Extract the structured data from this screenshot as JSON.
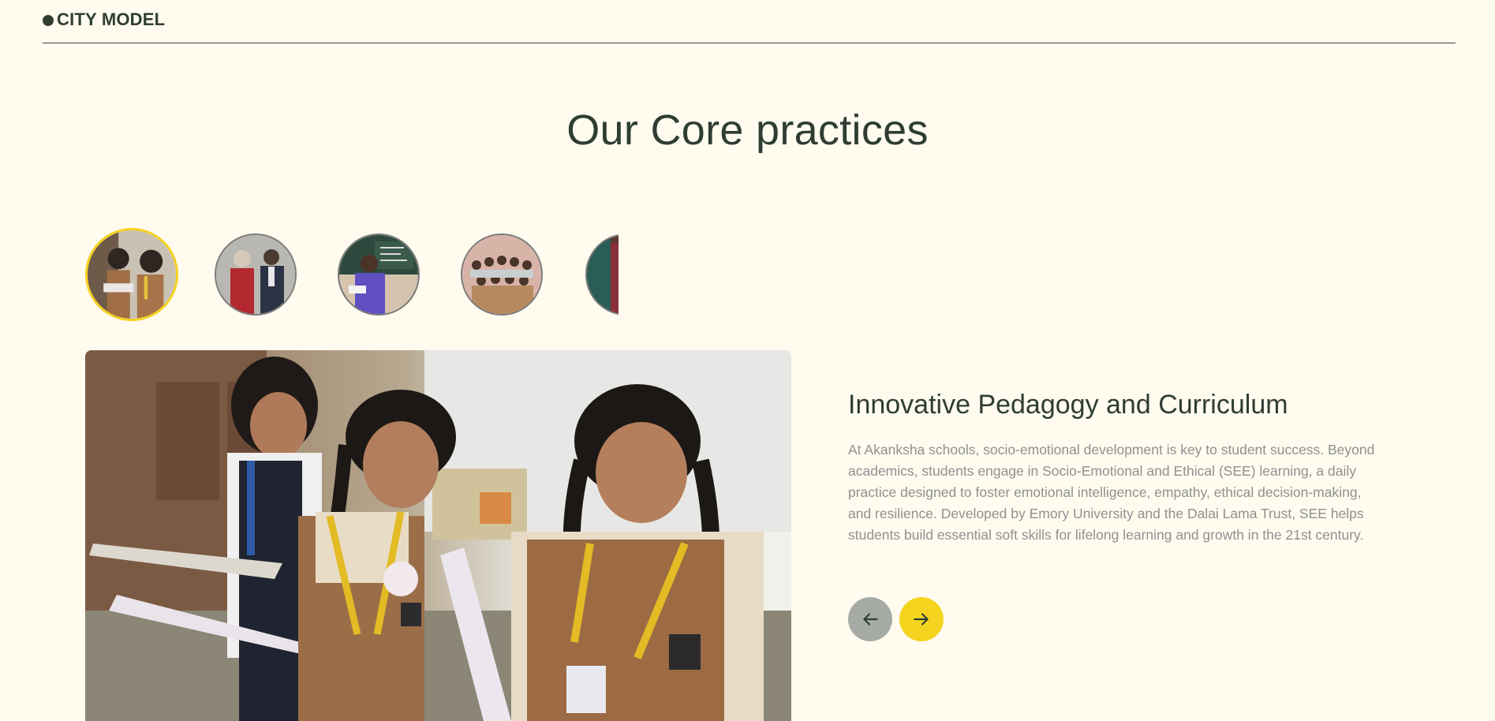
{
  "header": {
    "label": "CITY MODEL"
  },
  "section": {
    "title": "Our Core practices"
  },
  "thumbnails": [
    {
      "name": "students-reading",
      "active": true
    },
    {
      "name": "two-visitors",
      "active": false
    },
    {
      "name": "teacher-at-board",
      "active": false
    },
    {
      "name": "group-photo",
      "active": false
    },
    {
      "name": "classroom-partial",
      "active": false
    }
  ],
  "slide": {
    "title": "Innovative Pedagogy and Curriculum",
    "description": "At Akanksha schools, socio-emotional development is key to student success. Beyond academics, students engage in Socio-Emotional and Ethical (SEE) learning, a daily practice designed to foster emotional intelligence, empathy, ethical decision-making, and resilience. Developed by Emory University and the Dalai Lama Trust, SEE helps students build essential soft skills for lifelong learning and growth in the 21st century."
  },
  "controls": {
    "prev_icon": "arrow-left-icon",
    "next_icon": "arrow-right-icon"
  },
  "colors": {
    "background": "#fffbef",
    "accent": "#f5d41f",
    "text": "#2f3d33",
    "muted": "#8f9090"
  }
}
